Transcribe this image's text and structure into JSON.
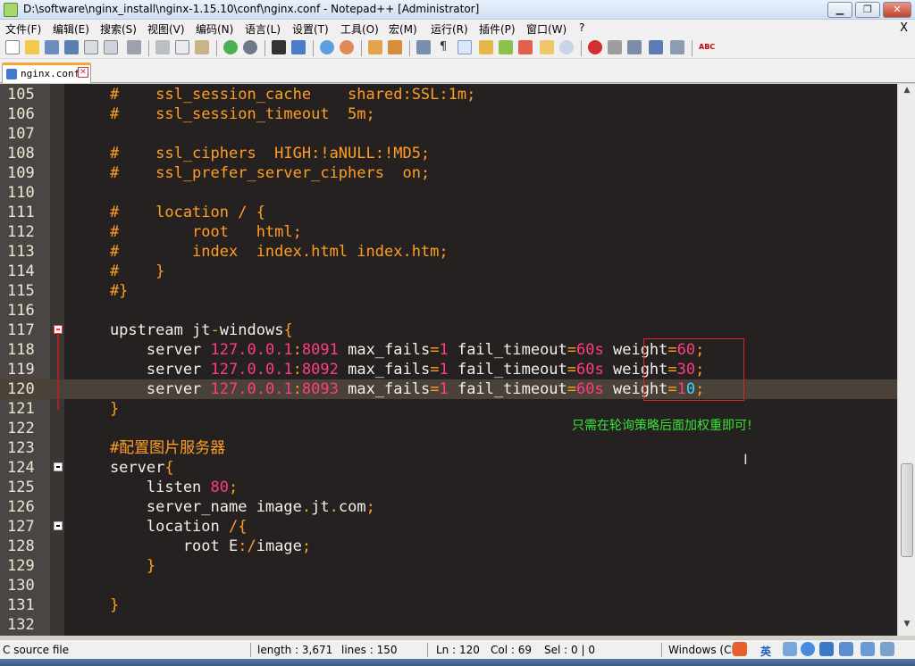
{
  "window": {
    "title": "D:\\software\\nginx_install\\nginx-1.15.10\\conf\\nginx.conf - Notepad++ [Administrator]",
    "minimize": "▁",
    "restore": "❐",
    "close": "✕"
  },
  "menu": {
    "items": [
      "文件(F)",
      "编辑(E)",
      "搜索(S)",
      "视图(V)",
      "编码(N)",
      "语言(L)",
      "设置(T)",
      "工具(O)",
      "宏(M)",
      "运行(R)",
      "插件(P)",
      "窗口(W)",
      "?"
    ],
    "close": "X"
  },
  "tab": {
    "label": "nginx.conf",
    "close": "✕"
  },
  "editor": {
    "annotation": "只需在轮询策略后面加权重即可!",
    "cursor_glyph": "I",
    "lines": [
      {
        "n": "105",
        "parts": [
          {
            "t": "    #    ssl_session_cache    shared:SSL:1m;",
            "c": "cm"
          }
        ]
      },
      {
        "n": "106",
        "parts": [
          {
            "t": "    #    ssl_session_timeout  5m;",
            "c": "cm"
          }
        ]
      },
      {
        "n": "107",
        "parts": []
      },
      {
        "n": "108",
        "parts": [
          {
            "t": "    #    ssl_ciphers  HIGH:!aNULL:!MD5;",
            "c": "cm"
          }
        ]
      },
      {
        "n": "109",
        "parts": [
          {
            "t": "    #    ssl_prefer_server_ciphers  on;",
            "c": "cm"
          }
        ]
      },
      {
        "n": "110",
        "parts": []
      },
      {
        "n": "111",
        "parts": [
          {
            "t": "    #    location / {",
            "c": "cm"
          }
        ]
      },
      {
        "n": "112",
        "parts": [
          {
            "t": "    #        root   html;",
            "c": "cm"
          }
        ]
      },
      {
        "n": "113",
        "parts": [
          {
            "t": "    #        index  index.html index.htm;",
            "c": "cm"
          }
        ]
      },
      {
        "n": "114",
        "parts": [
          {
            "t": "    #    }",
            "c": "cm"
          }
        ]
      },
      {
        "n": "115",
        "parts": [
          {
            "t": "    #}",
            "c": "cm"
          }
        ]
      },
      {
        "n": "116",
        "parts": []
      },
      {
        "n": "117",
        "parts": [
          {
            "t": "    upstream jt",
            "c": "tx"
          },
          {
            "t": "-",
            "c": "op"
          },
          {
            "t": "windows",
            "c": "tx"
          },
          {
            "t": "{",
            "c": "op"
          }
        ]
      },
      {
        "n": "118",
        "parts": [
          {
            "t": "        server ",
            "c": "tx"
          },
          {
            "t": "127.0.0.1",
            "c": "nm"
          },
          {
            "t": ":",
            "c": "op"
          },
          {
            "t": "8091",
            "c": "nm"
          },
          {
            "t": " max_fails",
            "c": "tx"
          },
          {
            "t": "=",
            "c": "op"
          },
          {
            "t": "1",
            "c": "nm"
          },
          {
            "t": " fail_timeout",
            "c": "tx"
          },
          {
            "t": "=",
            "c": "op"
          },
          {
            "t": "60s",
            "c": "nm"
          },
          {
            "t": " weight",
            "c": "tx"
          },
          {
            "t": "=",
            "c": "op"
          },
          {
            "t": "60",
            "c": "nm"
          },
          {
            "t": ";",
            "c": "op"
          }
        ]
      },
      {
        "n": "119",
        "parts": [
          {
            "t": "        server ",
            "c": "tx"
          },
          {
            "t": "127.0.0.1",
            "c": "nm"
          },
          {
            "t": ":",
            "c": "op"
          },
          {
            "t": "8092",
            "c": "nm"
          },
          {
            "t": " max_fails",
            "c": "tx"
          },
          {
            "t": "=",
            "c": "op"
          },
          {
            "t": "1",
            "c": "nm"
          },
          {
            "t": " fail_timeout",
            "c": "tx"
          },
          {
            "t": "=",
            "c": "op"
          },
          {
            "t": "60s",
            "c": "nm"
          },
          {
            "t": " weight",
            "c": "tx"
          },
          {
            "t": "=",
            "c": "op"
          },
          {
            "t": "30",
            "c": "nm"
          },
          {
            "t": ";",
            "c": "op"
          }
        ]
      },
      {
        "n": "120",
        "cur": true,
        "parts": [
          {
            "t": "        server ",
            "c": "tx"
          },
          {
            "t": "127.0.0.1",
            "c": "nm"
          },
          {
            "t": ":",
            "c": "op"
          },
          {
            "t": "8093",
            "c": "nm"
          },
          {
            "t": " max_fails",
            "c": "tx"
          },
          {
            "t": "=",
            "c": "op"
          },
          {
            "t": "1",
            "c": "nm"
          },
          {
            "t": " fail_timeout",
            "c": "tx"
          },
          {
            "t": "=",
            "c": "op"
          },
          {
            "t": "60s",
            "c": "nm"
          },
          {
            "t": " weight",
            "c": "tx"
          },
          {
            "t": "=",
            "c": "op"
          },
          {
            "t": "1",
            "c": "nm"
          },
          {
            "t": "0",
            "c": "ch"
          },
          {
            "t": ";",
            "c": "op"
          }
        ]
      },
      {
        "n": "121",
        "parts": [
          {
            "t": "    }",
            "c": "op"
          }
        ]
      },
      {
        "n": "122",
        "parts": []
      },
      {
        "n": "123",
        "parts": [
          {
            "t": "    #配置图片服务器",
            "c": "cm"
          }
        ]
      },
      {
        "n": "124",
        "parts": [
          {
            "t": "    server",
            "c": "tx"
          },
          {
            "t": "{",
            "c": "op"
          }
        ]
      },
      {
        "n": "125",
        "parts": [
          {
            "t": "        listen ",
            "c": "tx"
          },
          {
            "t": "80",
            "c": "nm"
          },
          {
            "t": ";",
            "c": "op"
          }
        ]
      },
      {
        "n": "126",
        "parts": [
          {
            "t": "        server_name image",
            "c": "tx"
          },
          {
            "t": ".",
            "c": "op"
          },
          {
            "t": "jt",
            "c": "tx"
          },
          {
            "t": ".",
            "c": "op"
          },
          {
            "t": "com",
            "c": "tx"
          },
          {
            "t": ";",
            "c": "op"
          }
        ]
      },
      {
        "n": "127",
        "parts": [
          {
            "t": "        location ",
            "c": "tx"
          },
          {
            "t": "/{",
            "c": "op"
          }
        ]
      },
      {
        "n": "128",
        "parts": [
          {
            "t": "            root E",
            "c": "tx"
          },
          {
            "t": ":/",
            "c": "op"
          },
          {
            "t": "image",
            "c": "tx"
          },
          {
            "t": ";",
            "c": "op"
          }
        ]
      },
      {
        "n": "129",
        "parts": [
          {
            "t": "        }",
            "c": "op"
          }
        ]
      },
      {
        "n": "130",
        "parts": []
      },
      {
        "n": "131",
        "parts": [
          {
            "t": "    }",
            "c": "op"
          }
        ]
      },
      {
        "n": "132",
        "parts": []
      }
    ]
  },
  "statusbar": {
    "filetype": "C source file",
    "length": "length : 3,671",
    "lines": "lines : 150",
    "ln": "Ln : 120",
    "col": "Col : 69",
    "sel": "Sel : 0 | 0",
    "eol": "Windows (CR",
    "ime_lang": "英"
  },
  "colors": {
    "editor_bg": "#262121",
    "comment": "#ff9e22",
    "number": "#ff3d7f",
    "annotation": "#37e337",
    "highlight_box": "#e02424"
  }
}
